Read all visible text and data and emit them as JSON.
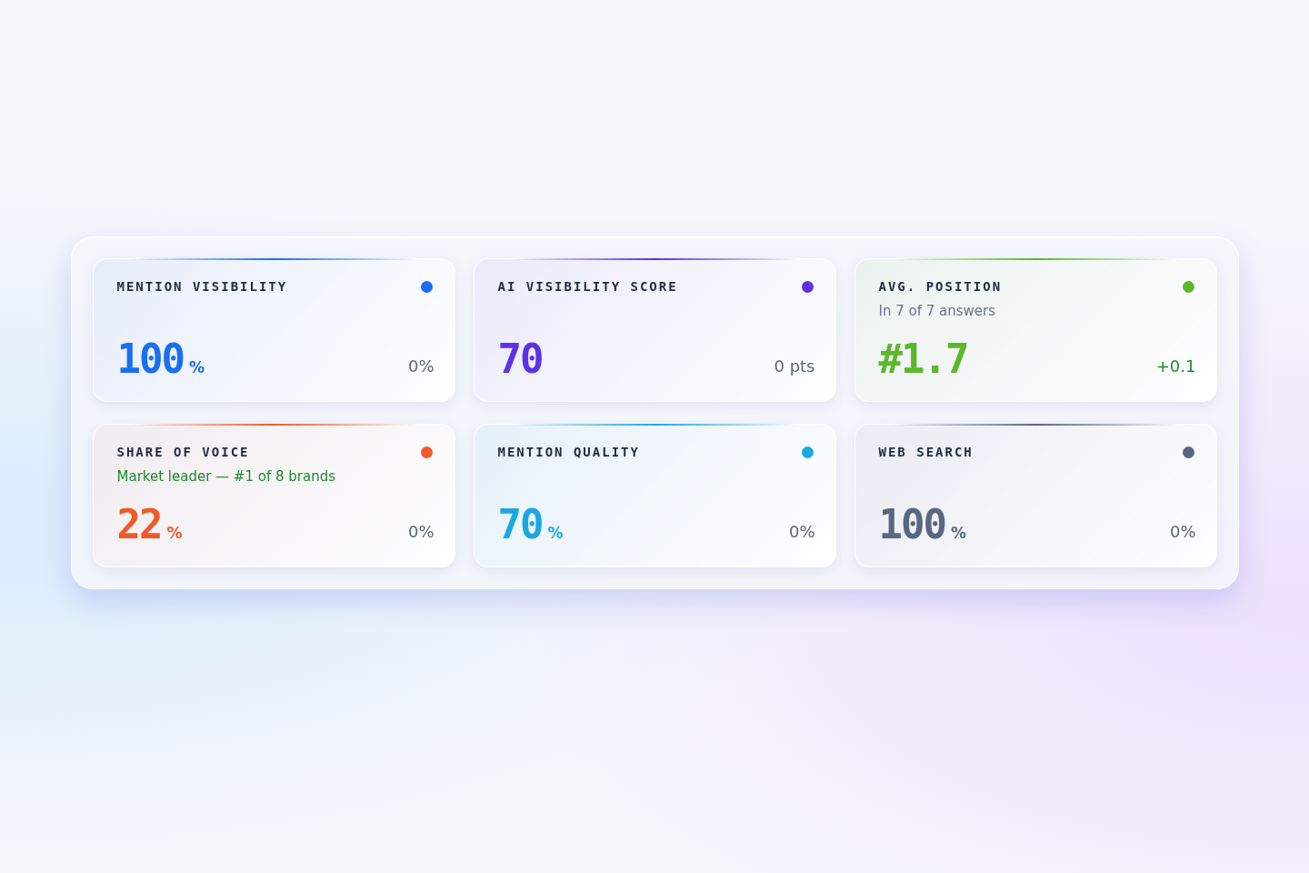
{
  "metrics": [
    {
      "label": "MENTION VISIBILITY",
      "color": "#1a6ef0",
      "value": "100",
      "unit": "%",
      "delta": {
        "text": "0%",
        "positive": false
      }
    },
    {
      "label": "AI VISIBILITY SCORE",
      "color": "#5b32e6",
      "value": "70",
      "delta": {
        "text": "0 pts",
        "positive": false
      }
    },
    {
      "label": "AVG. POSITION",
      "color": "#5cb82a",
      "subtitle": {
        "text": "In 7 of 7 answers",
        "positive": false
      },
      "value": "#1.7",
      "delta": {
        "text": "+0.1",
        "positive": true
      }
    },
    {
      "label": "SHARE OF VOICE",
      "color": "#f05a2a",
      "subtitle": {
        "text": "Market leader — #1 of 8 brands",
        "positive": true
      },
      "value": "22",
      "unit": "%",
      "delta": {
        "text": "0%",
        "positive": false
      }
    },
    {
      "label": "MENTION QUALITY",
      "color": "#1aa8e0",
      "value": "70",
      "unit": "%",
      "delta": {
        "text": "0%",
        "positive": false
      }
    },
    {
      "label": "WEB SEARCH",
      "color": "#5a6780",
      "value": "100",
      "unit": "%",
      "delta": {
        "text": "0%",
        "positive": false
      }
    }
  ]
}
